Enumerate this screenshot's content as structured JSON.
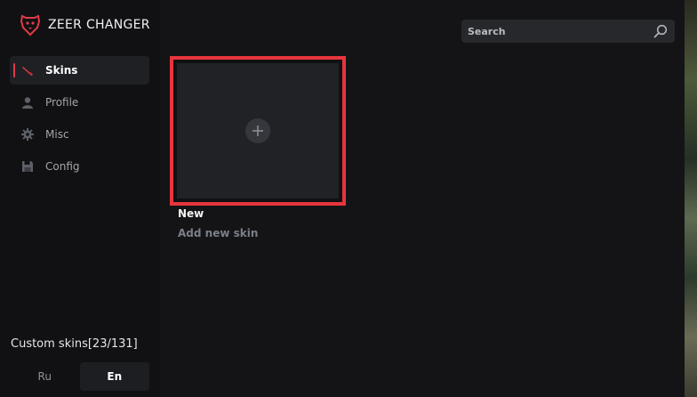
{
  "app": {
    "title": "ZEER CHANGER",
    "accent": "#e8353d"
  },
  "sidebar": {
    "items": [
      {
        "label": "Skins",
        "icon": "knife-icon",
        "active": true
      },
      {
        "label": "Profile",
        "icon": "user-icon",
        "active": false
      },
      {
        "label": "Misc",
        "icon": "gear-icon",
        "active": false
      },
      {
        "label": "Config",
        "icon": "save-icon",
        "active": false
      }
    ],
    "stats": "Custom skins[23/131]",
    "languages": [
      {
        "label": "Ru",
        "active": false
      },
      {
        "label": "En",
        "active": true
      }
    ]
  },
  "search": {
    "placeholder": "Search",
    "value": ""
  },
  "main": {
    "card": {
      "title": "New",
      "subtitle": "Add new skin"
    }
  }
}
